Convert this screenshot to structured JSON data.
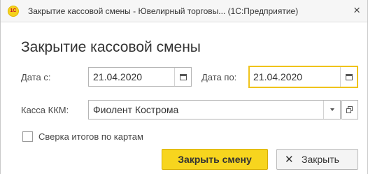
{
  "window": {
    "title": "Закрытие кассовой смены - Ювелирный торговы... (1С:Предприятие)",
    "logo_text": "1С",
    "close_glyph": "×"
  },
  "form": {
    "title": "Закрытие кассовой смены",
    "date_from_label": "Дата с:",
    "date_from_value": "21.04.2020",
    "date_to_label": "Дата по:",
    "date_to_value": "21.04.2020",
    "kkm_label": "Касса ККМ:",
    "kkm_value": "Фиолент Кострома",
    "checkbox_label": "Сверка итогов по картам",
    "checkbox_checked": false
  },
  "actions": {
    "close_shift_label": "Закрыть смену",
    "close_label": "Закрыть",
    "close_icon_glyph": "✕"
  },
  "colors": {
    "accent_yellow": "#f7d51e",
    "focus_border": "#f0c31a"
  },
  "icons": {
    "calendar": "calendar-icon",
    "dropdown": "chevron-down-icon",
    "open": "open-item-icon"
  }
}
